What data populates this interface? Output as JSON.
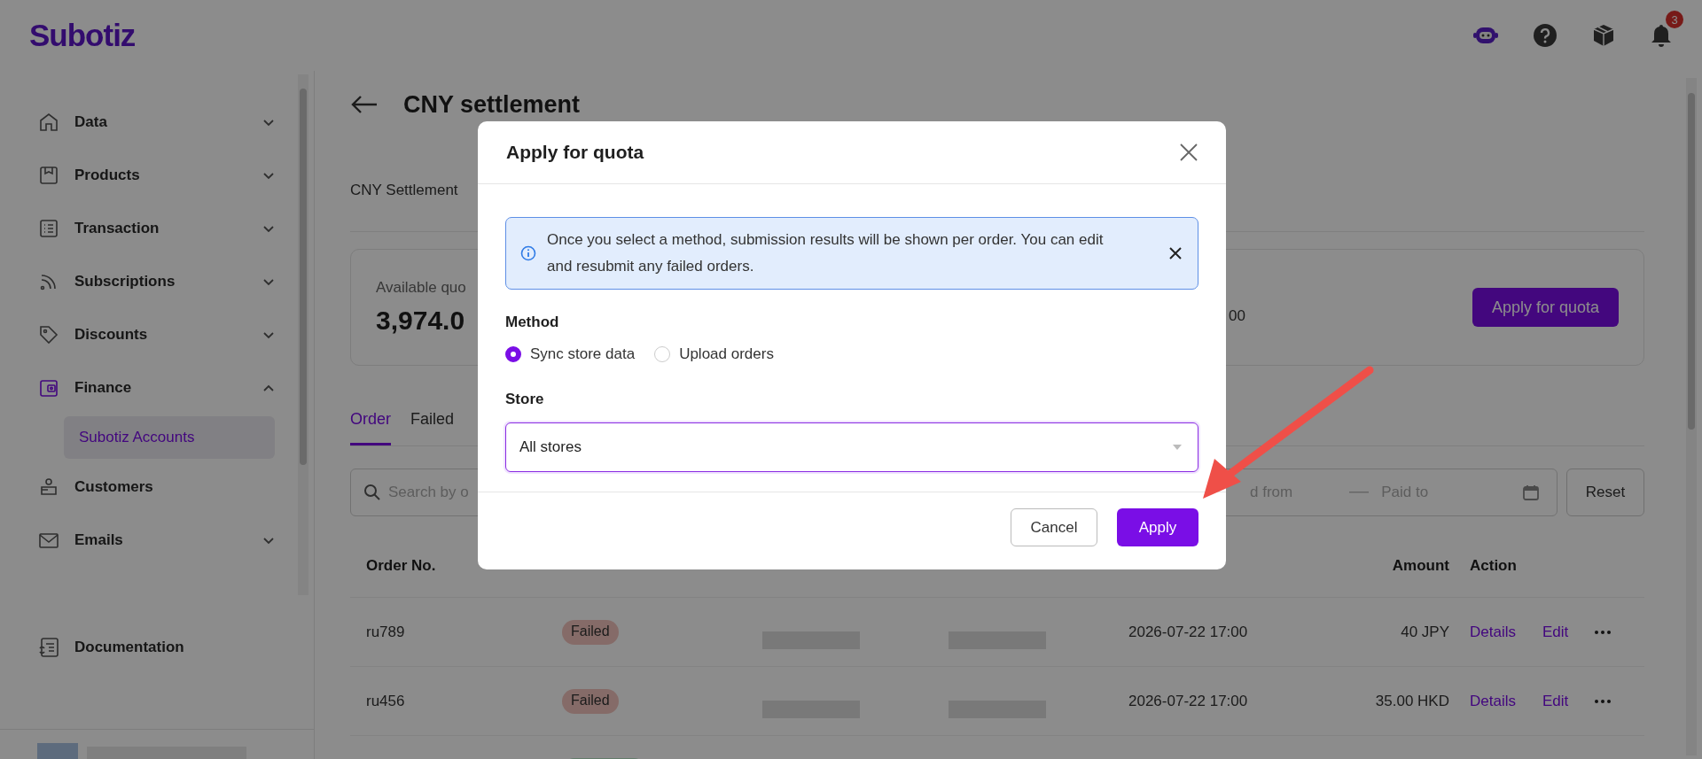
{
  "header": {
    "logo": "Subotiz",
    "notification_count": "3"
  },
  "sidebar": {
    "items": [
      {
        "label": "Data",
        "kind": "group",
        "expanded": false
      },
      {
        "label": "Products",
        "kind": "group",
        "expanded": false
      },
      {
        "label": "Transaction",
        "kind": "group",
        "expanded": false
      },
      {
        "label": "Subscriptions",
        "kind": "group",
        "expanded": false
      },
      {
        "label": "Discounts",
        "kind": "group",
        "expanded": false
      },
      {
        "label": "Finance",
        "kind": "group",
        "expanded": true,
        "children": [
          {
            "label": "Subotiz Accounts",
            "selected": true
          }
        ]
      },
      {
        "label": "Customers",
        "kind": "link",
        "expanded": false
      },
      {
        "label": "Emails",
        "kind": "group",
        "expanded": false
      }
    ],
    "footer_item": "Documentation"
  },
  "page": {
    "title": "CNY settlement",
    "section": "CNY Settlement",
    "quota_card": {
      "label": "Available quo",
      "amount": "3,974.0",
      "column_2_value": "00",
      "button": "Apply for quota"
    },
    "list_tabs": [
      {
        "label": "Order",
        "selected": true
      },
      {
        "label": "Failed",
        "selected": false
      }
    ],
    "filters": {
      "search_placeholder": "Search by o",
      "date_from_placeholder": "d from",
      "date_to_placeholder": "Paid to",
      "reset": "Reset"
    },
    "table": {
      "header": {
        "order_no": "Order No.",
        "amount": "Amount",
        "action": "Action"
      },
      "rows": [
        {
          "order_no": "ru789",
          "status": "Failed",
          "kind": "failed",
          "paid_at": "2026-07-22 17:00",
          "amount": "40 JPY",
          "actions": [
            "Details",
            "Edit"
          ]
        },
        {
          "order_no": "ru456",
          "status": "Failed",
          "kind": "failed",
          "paid_at": "2026-07-22 17:00",
          "amount": "35.00 HKD",
          "actions": [
            "Details",
            "Edit"
          ]
        },
        {
          "kind": "success"
        }
      ]
    }
  },
  "dialog": {
    "title": "Apply for quota",
    "notice": "Once you select a method, submission results will be shown per order. You can edit and resubmit any failed orders.",
    "method_label": "Method",
    "methods": [
      {
        "label": "Sync store data",
        "selected": true
      },
      {
        "label": "Upload orders",
        "selected": false
      }
    ],
    "store_label": "Store",
    "store_value": "All stores",
    "buttons": [
      {
        "label": "Cancel",
        "kind": "secondary"
      },
      {
        "label": "Apply",
        "kind": "primary"
      }
    ]
  }
}
